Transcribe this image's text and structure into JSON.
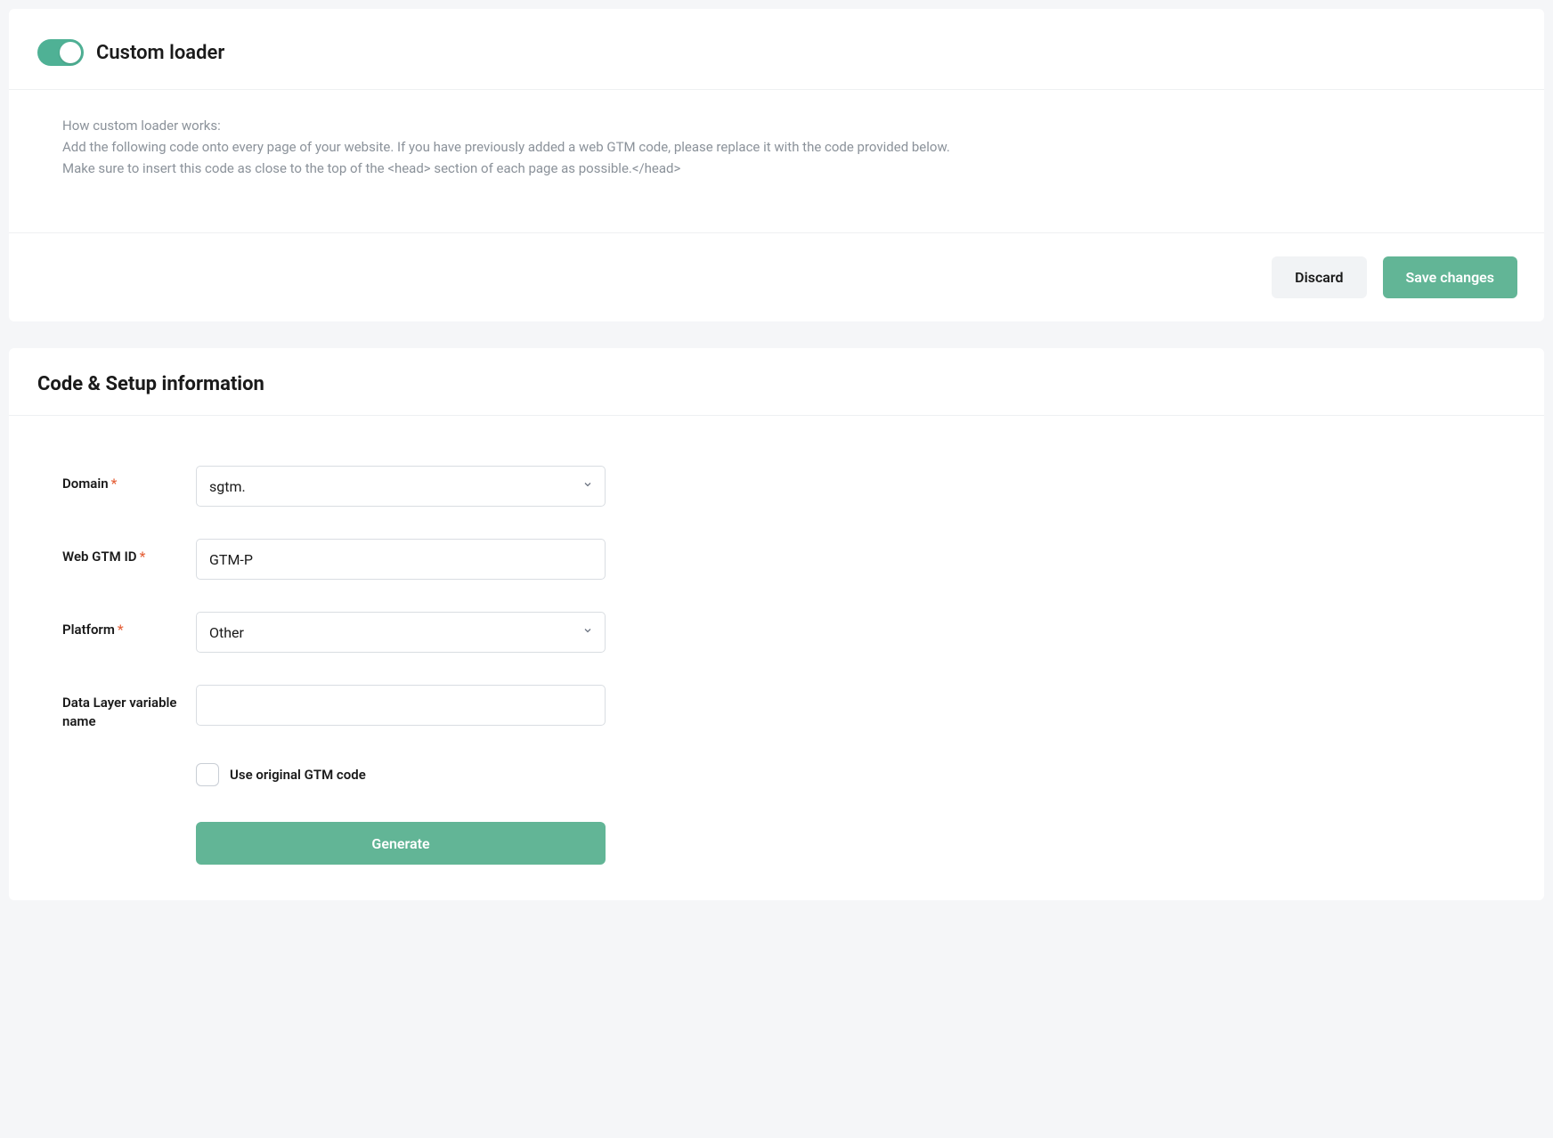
{
  "loader": {
    "title": "Custom loader",
    "toggle_on": true,
    "info_line1": "How custom loader works:",
    "info_line2": "Add the following code onto every page of your website. If you have previously added a web GTM code, please replace it with the code provided below.",
    "info_line3": "Make sure to insert this code as close to the top of the <head> section of each page as possible.</head>"
  },
  "actions": {
    "discard": "Discard",
    "save": "Save changes"
  },
  "setup": {
    "heading": "Code & Setup information",
    "labels": {
      "domain": "Domain",
      "gtm_id": "Web GTM ID",
      "platform": "Platform",
      "data_layer": "Data Layer variable name"
    },
    "fields": {
      "domain": "sgtm.",
      "gtm_id": "GTM-P",
      "platform": "Other",
      "data_layer": ""
    },
    "checkbox": {
      "label": "Use original GTM code",
      "checked": false
    },
    "generate": "Generate"
  }
}
